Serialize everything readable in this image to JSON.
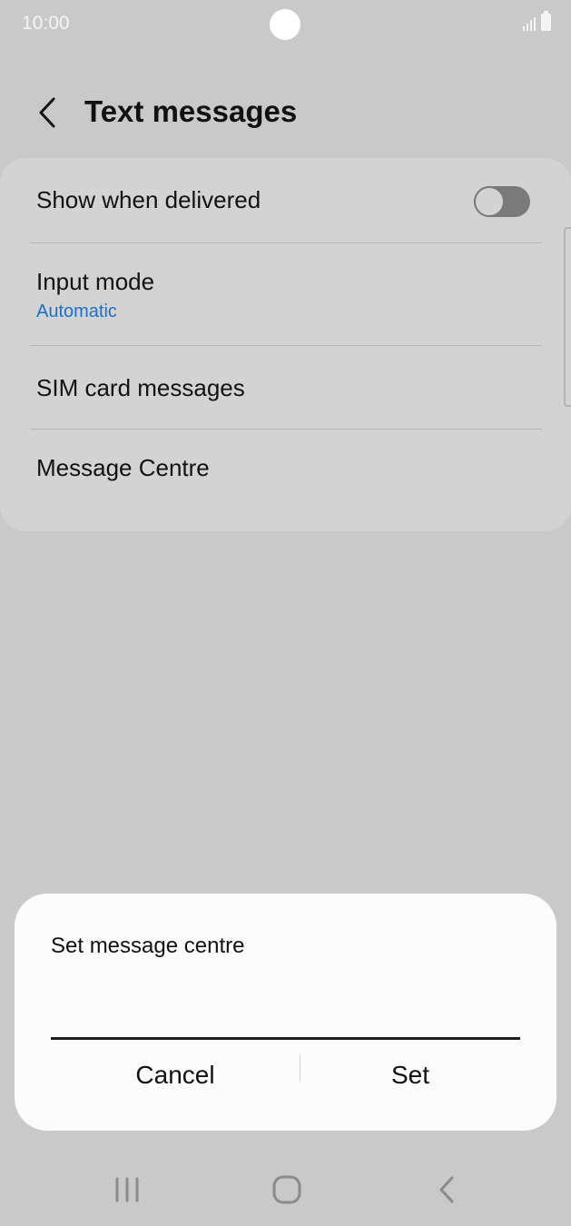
{
  "status_bar": {
    "time": "10:00",
    "icons": [
      "signal-icon",
      "battery-icon"
    ]
  },
  "header": {
    "back_icon": "chevron-left-icon",
    "title": "Text messages"
  },
  "settings": {
    "show_when_delivered": {
      "label": "Show when delivered",
      "toggle_on": false
    },
    "input_mode": {
      "label": "Input mode",
      "value": "Automatic"
    },
    "sim_card_messages": {
      "label": "SIM card messages"
    },
    "message_centre": {
      "label": "Message Centre"
    }
  },
  "dialog": {
    "title": "Set message centre",
    "input_value": "",
    "cancel_label": "Cancel",
    "set_label": "Set"
  },
  "nav_bar": {
    "items": [
      "recent-apps-icon",
      "home-icon",
      "back-icon"
    ]
  },
  "colors": {
    "background": "#c9c9c9",
    "card": "#d3d3d3",
    "accent": "#1a6fc9",
    "dialog": "#fcfcfc"
  }
}
